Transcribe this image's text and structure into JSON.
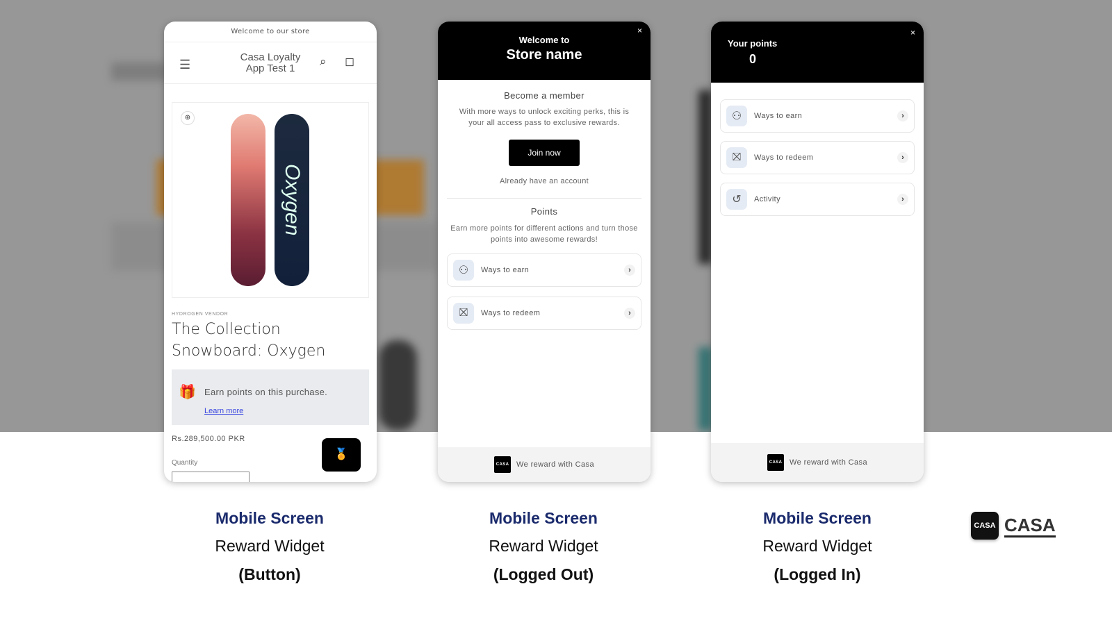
{
  "store_panel": {
    "announcement": "Welcome to our store",
    "store_title_line1": "Casa Loyalty",
    "store_title_line2": "App Test 1",
    "vendor": "HYDROGEN VENDOR",
    "product_title": "The Collection Snowboard: Oxygen",
    "earn_text": "Earn points on this purchase.",
    "learn_more": "Learn more",
    "price": "Rs.289,500.00 PKR",
    "quantity_label": "Quantity",
    "board_text": "Oxygen"
  },
  "logged_out_panel": {
    "welcome": "Welcome to",
    "store_name": "Store name",
    "close": "×",
    "member_title": "Become a member",
    "member_desc": "With more ways to unlock exciting perks, this is your all access pass to exclusive rewards.",
    "join_label": "Join now",
    "signin": "Already have an account",
    "points_title": "Points",
    "points_desc": "Earn more points for different actions and turn those points into awesome rewards!",
    "rows": [
      {
        "label": "Ways to earn",
        "icon": "hand-coins-icon"
      },
      {
        "label": "Ways to redeem",
        "icon": "gift-icon"
      }
    ],
    "footer": "We reward with Casa",
    "footer_logo": "CASA"
  },
  "logged_in_panel": {
    "points_label": "Your points",
    "points_value": "0",
    "close": "×",
    "rows": [
      {
        "label": "Ways to earn",
        "icon": "hand-coins-icon"
      },
      {
        "label": "Ways to redeem",
        "icon": "gift-icon"
      },
      {
        "label": "Activity",
        "icon": "history-icon"
      }
    ],
    "footer": "We reward with Casa",
    "footer_logo": "CASA"
  },
  "captions": [
    {
      "title": "Mobile Screen",
      "subtitle": "Reward Widget",
      "variant": "(Button)"
    },
    {
      "title": "Mobile Screen",
      "subtitle": "Reward Widget",
      "variant": "(Logged Out)"
    },
    {
      "title": "Mobile Screen",
      "subtitle": "Reward Widget",
      "variant": "(Logged In)"
    }
  ],
  "brand": {
    "mark": "CASA",
    "wordmark": "CASA"
  },
  "colors": {
    "caption_title": "#1a2a6c",
    "widget_dark": "#000000",
    "link": "#3b46e0"
  }
}
